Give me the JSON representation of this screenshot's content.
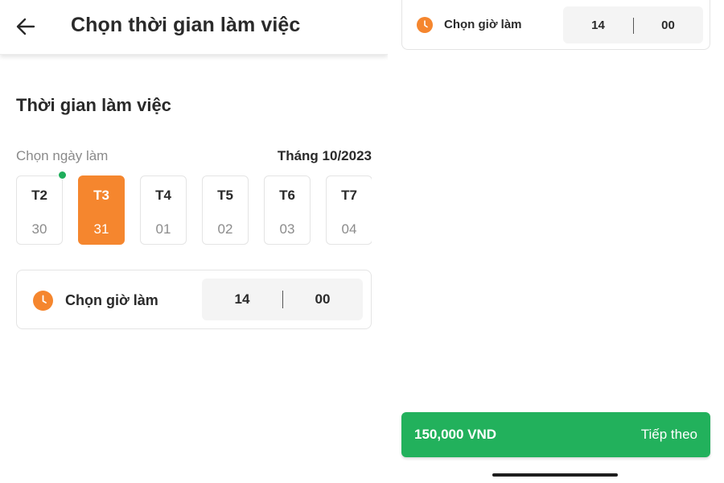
{
  "header": {
    "title": "Chọn thời gian làm việc",
    "back_icon": "arrow-left-icon"
  },
  "section_title": "Thời gian làm việc",
  "day_picker": {
    "label": "Chọn ngày làm",
    "month": "Tháng 10/2023",
    "days": [
      {
        "dow": "T2",
        "dom": "30"
      },
      {
        "dow": "T3",
        "dom": "31"
      },
      {
        "dow": "T4",
        "dom": "01"
      },
      {
        "dow": "T5",
        "dom": "02"
      },
      {
        "dow": "T6",
        "dom": "03"
      },
      {
        "dow": "T7",
        "dom": "04"
      }
    ],
    "selected_index": 1,
    "today_index": 0
  },
  "time_picker": {
    "label": "Chọn giờ làm",
    "hour": "14",
    "minute": "00",
    "icon": "clock-icon"
  },
  "footer": {
    "price": "150,000 VND",
    "next_label": "Tiếp theo"
  },
  "colors": {
    "accent_orange": "#f5862e",
    "accent_green": "#22b15c",
    "today_dot": "#1fae5b"
  }
}
